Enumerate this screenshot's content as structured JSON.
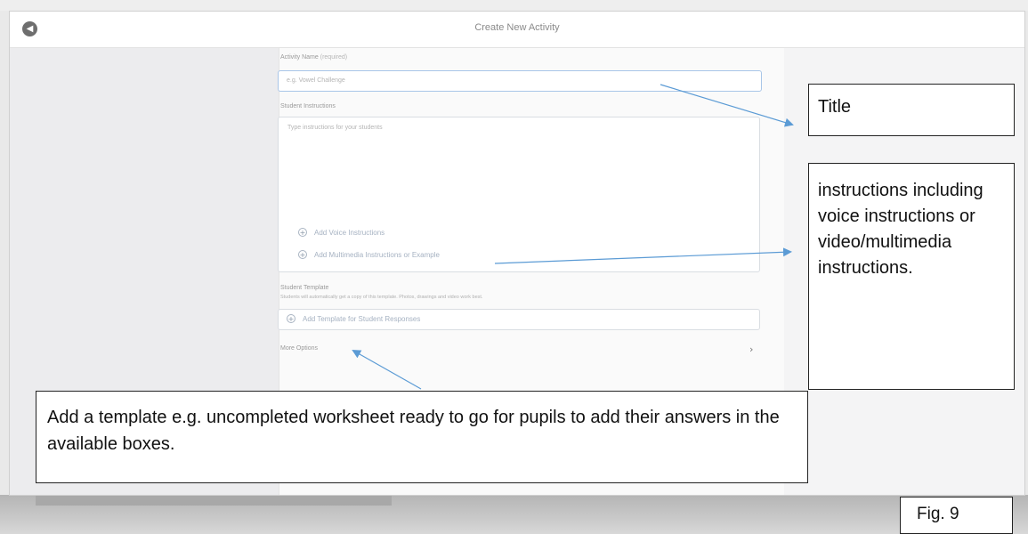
{
  "window": {
    "title": "Create New Activity",
    "back_icon": "back-arrow-icon"
  },
  "form": {
    "activity_name": {
      "label": "Activity Name",
      "sub": "(required)",
      "placeholder": "e.g. Vowel Challenge"
    },
    "student_instructions": {
      "label": "Student Instructions",
      "placeholder": "Type instructions for your students",
      "add_voice": "Add Voice Instructions",
      "add_multimedia": "Add Multimedia Instructions or Example"
    },
    "student_template": {
      "label": "Student Template",
      "description": "Students will automatically get a copy of this template. Photos, drawings and video work best.",
      "add_template": "Add Template for Student Responses"
    },
    "more_options": "More Options"
  },
  "callouts": {
    "title": "Title",
    "instructions": "instructions including voice instructions or video/multimedia instructions.",
    "template": "Add a template e.g. uncompleted worksheet ready to go for pupils to add their answers in the available boxes."
  },
  "figure_label": "Fig. 9",
  "colors": {
    "arrow": "#5b9bd5",
    "input_focus": "#a9c6e8"
  }
}
